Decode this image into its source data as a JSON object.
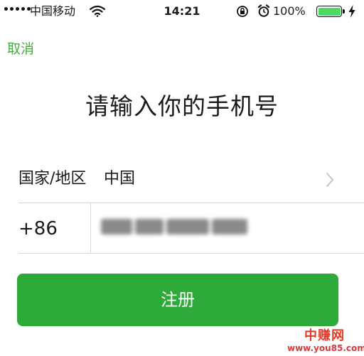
{
  "status_bar": {
    "carrier": "中国移动",
    "time": "14:21",
    "battery_text": "100%",
    "battery_level": 1.0,
    "colors": {
      "battery_fill": "#4cd964"
    },
    "icons": [
      "signal-dots",
      "wifi-icon",
      "rotation-lock-icon",
      "alarm-icon",
      "battery-icon",
      "charging-bolt-icon"
    ]
  },
  "nav": {
    "cancel_label": "取消",
    "accent_color": "#3fae3a"
  },
  "title": "请输入你的手机号",
  "form": {
    "country_label": "国家/地区",
    "country_value": "中国",
    "country_code": "+86",
    "phone_obscured": true
  },
  "register_button": {
    "label": "注册",
    "color": "#2eaa3b"
  },
  "watermark": {
    "top": "中赚网",
    "bottom": "www.you85.com"
  }
}
